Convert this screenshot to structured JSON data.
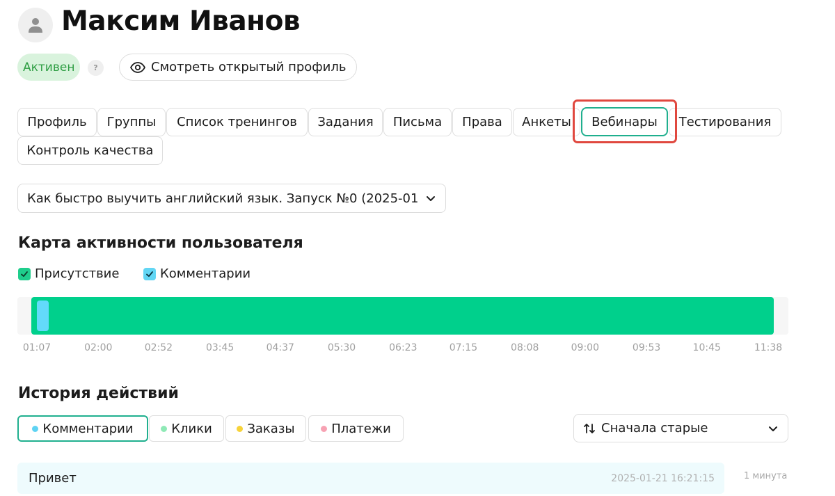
{
  "user": {
    "name": "Максим Иванов",
    "avatar_icon": "user-silhouette-icon",
    "status": "Активен",
    "status_color": "#2e9e43",
    "help_mark": "?",
    "public_profile_label": "Смотреть открытый профиль",
    "public_profile_icon": "eye-icon"
  },
  "tabs": [
    {
      "label": "Профиль",
      "active": false
    },
    {
      "label": "Группы",
      "active": false
    },
    {
      "label": "Список тренингов",
      "active": false
    },
    {
      "label": "Задания",
      "active": false
    },
    {
      "label": "Письма",
      "active": false
    },
    {
      "label": "Права",
      "active": false
    },
    {
      "label": "Анкеты",
      "active": false
    },
    {
      "label": "Вебинары",
      "active": true
    },
    {
      "label": "Тестирования",
      "active": false
    },
    {
      "label": "Контроль качества",
      "active": false
    }
  ],
  "webinar_select": {
    "value": "Как быстро выучить английский язык. Запуск №0 (2025-01"
  },
  "activity_map": {
    "title": "Карта активности пользователя",
    "legend": [
      {
        "label": "Присутствие",
        "checked": true,
        "color": "#1fce8c"
      },
      {
        "label": "Комментарии",
        "checked": true,
        "color": "#62d6f4"
      }
    ],
    "presence_color": "#00d08c",
    "comment_color": "#63dafa",
    "time_labels": [
      "01:07",
      "02:00",
      "02:52",
      "03:45",
      "04:37",
      "05:30",
      "06:23",
      "07:15",
      "08:08",
      "09:00",
      "09:53",
      "10:45",
      "11:38"
    ],
    "presence_intervals": [
      {
        "start": "01:07",
        "end": "11:38"
      }
    ],
    "comment_marks": [
      {
        "time": "01:07"
      }
    ]
  },
  "history": {
    "title": "История действий",
    "filters": [
      {
        "label": "Комментарии",
        "color": "#5fd3f3",
        "active": true
      },
      {
        "label": "Клики",
        "color": "#8fe9b6",
        "active": false
      },
      {
        "label": "Заказы",
        "color": "#f7d33a",
        "active": false
      },
      {
        "label": "Платежи",
        "color": "#f7a2b3",
        "active": false
      }
    ],
    "sort": {
      "value": "Сначала старые",
      "icon": "sort-arrows-icon"
    },
    "entries": [
      {
        "text": "Привет",
        "datetime": "2025-01-21 16:21:15",
        "duration": "1 минута"
      }
    ]
  },
  "colors": {
    "accent_border": "#1faf8e",
    "highlight": "#e0483f"
  }
}
